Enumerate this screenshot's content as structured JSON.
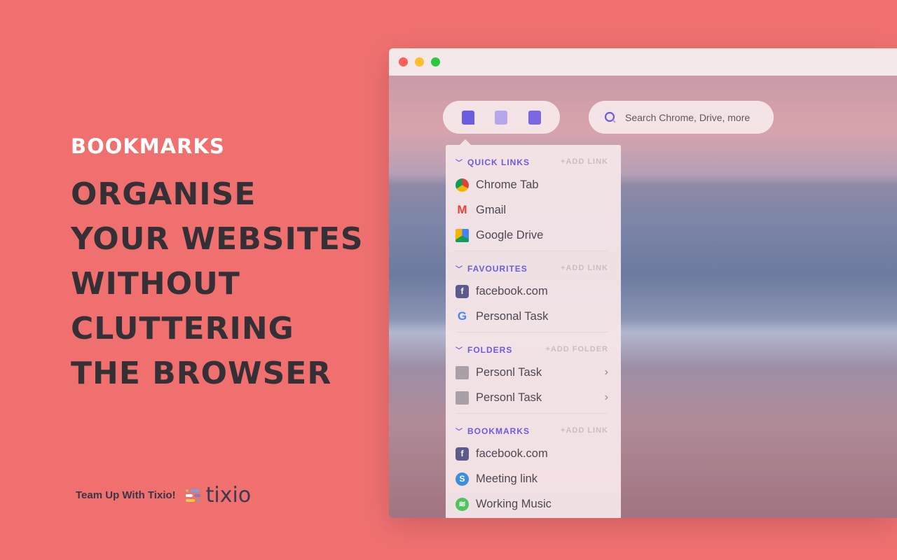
{
  "hero": {
    "eyebrow": "BOOKMARKS",
    "headline": "ORGANISE YOUR WEBSITES WITHOUT CLUTTERING THE BROWSER"
  },
  "footer": {
    "tagline": "Team Up With Tixio!",
    "brand": "tixio"
  },
  "browser": {
    "search_placeholder": "Search Chrome, Drive, more",
    "toolbar_icons": [
      "bookmark-icon",
      "document-icon",
      "calendar-icon"
    ]
  },
  "colors": {
    "background": "#f07070",
    "accent": "#6b5be0"
  },
  "sections": [
    {
      "title": "QUICK LINKS",
      "action": "+ADD LINK",
      "items": [
        {
          "label": "Chrome Tab",
          "icon": "chrome-icon"
        },
        {
          "label": "Gmail",
          "icon": "gmail-icon"
        },
        {
          "label": "Google Drive",
          "icon": "google-drive-icon"
        }
      ]
    },
    {
      "title": "FAVOURITES",
      "action": "+ADD LINK",
      "items": [
        {
          "label": "facebook.com",
          "icon": "facebook-icon"
        },
        {
          "label": "Personal Task",
          "icon": "google-icon"
        }
      ]
    },
    {
      "title": "FOLDERS",
      "action": "+ADD FOLDER",
      "items": [
        {
          "label": "Personl Task",
          "icon": "folder-icon"
        },
        {
          "label": "Personl Task",
          "icon": "folder-icon"
        }
      ]
    },
    {
      "title": "BOOKMARKS",
      "action": "+ADD LINK",
      "items": [
        {
          "label": "facebook.com",
          "icon": "facebook-icon"
        },
        {
          "label": "Meeting link",
          "icon": "skype-icon"
        },
        {
          "label": "Working Music",
          "icon": "spotify-icon"
        }
      ]
    }
  ]
}
